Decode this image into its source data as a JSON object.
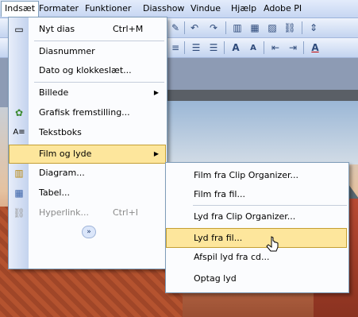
{
  "menubar": {
    "items": [
      "Indsæt",
      "Formater",
      "Funktioner",
      "Diasshow",
      "Vindue",
      "Hjælp",
      "Adobe PI"
    ]
  },
  "menu": {
    "items": [
      {
        "label": "Nyt dias",
        "shortcut": "Ctrl+M",
        "icon": "new-slide-icon"
      },
      {
        "label": "Diasnummer",
        "shortcut": "",
        "icon": ""
      },
      {
        "label": "Dato og klokkeslæt...",
        "shortcut": "",
        "icon": ""
      },
      {
        "label": "Billede",
        "shortcut": "",
        "icon": "",
        "submenu": true
      },
      {
        "label": "Grafisk fremstilling...",
        "shortcut": "",
        "icon": "diagram-gallery-icon"
      },
      {
        "label": "Tekstboks",
        "shortcut": "",
        "icon": "textbox-icon"
      },
      {
        "label": "Film og lyde",
        "shortcut": "",
        "icon": "",
        "submenu": true,
        "highlighted": true
      },
      {
        "label": "Diagram...",
        "shortcut": "",
        "icon": "chart-icon"
      },
      {
        "label": "Tabel...",
        "shortcut": "",
        "icon": "table-icon"
      },
      {
        "label": "Hyperlink...",
        "shortcut": "Ctrl+I",
        "icon": "hyperlink-icon",
        "disabled": true
      }
    ],
    "expand_glyph": "»"
  },
  "submenu": {
    "items": [
      {
        "label": "Film fra Clip Organizer..."
      },
      {
        "label": "Film fra fil..."
      },
      {
        "label": "Lyd fra Clip Organizer..."
      },
      {
        "label": "Lyd fra fil...",
        "highlighted": true
      },
      {
        "label": "Afspil lyd fra cd..."
      },
      {
        "label": "Optag lyd"
      }
    ]
  },
  "submenu_arrow": "▶",
  "colors": {
    "highlight": "#fde69c",
    "highlight_border": "#c49f34",
    "menu_border": "#7f9db9"
  }
}
